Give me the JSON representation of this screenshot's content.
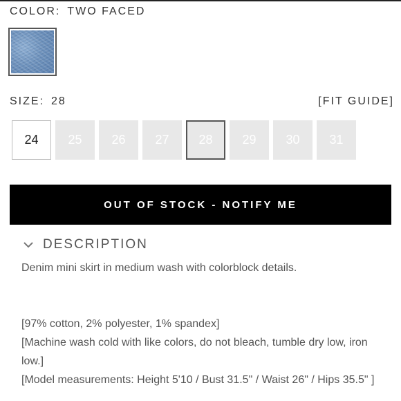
{
  "color": {
    "label": "COLOR:",
    "value": "TWO FACED",
    "swatch_name": "denim-swatch"
  },
  "size": {
    "label": "SIZE:",
    "value": "28",
    "fit_guide": "[FIT GUIDE]",
    "options": [
      {
        "label": "24",
        "available": true
      },
      {
        "label": "25",
        "available": false
      },
      {
        "label": "26",
        "available": false
      },
      {
        "label": "27",
        "available": false
      },
      {
        "label": "28",
        "available": false,
        "selected": true
      },
      {
        "label": "29",
        "available": false
      },
      {
        "label": "30",
        "available": false
      },
      {
        "label": "31",
        "available": false
      }
    ]
  },
  "cta": {
    "label": "OUT OF STOCK - NOTIFY ME"
  },
  "description": {
    "title": "DESCRIPTION",
    "summary": "Denim mini skirt in medium wash with colorblock details.",
    "material": "[97% cotton, 2% polyester, 1% spandex]",
    "care": "[Machine wash cold with like colors, do not bleach, tumble dry low, iron low.]",
    "model": "[Model measurements: Height 5'10 / Bust 31.5\" / Waist 26\" / Hips 35.5\" ]"
  },
  "icons": {
    "toggle": "chevron-down-icon"
  }
}
